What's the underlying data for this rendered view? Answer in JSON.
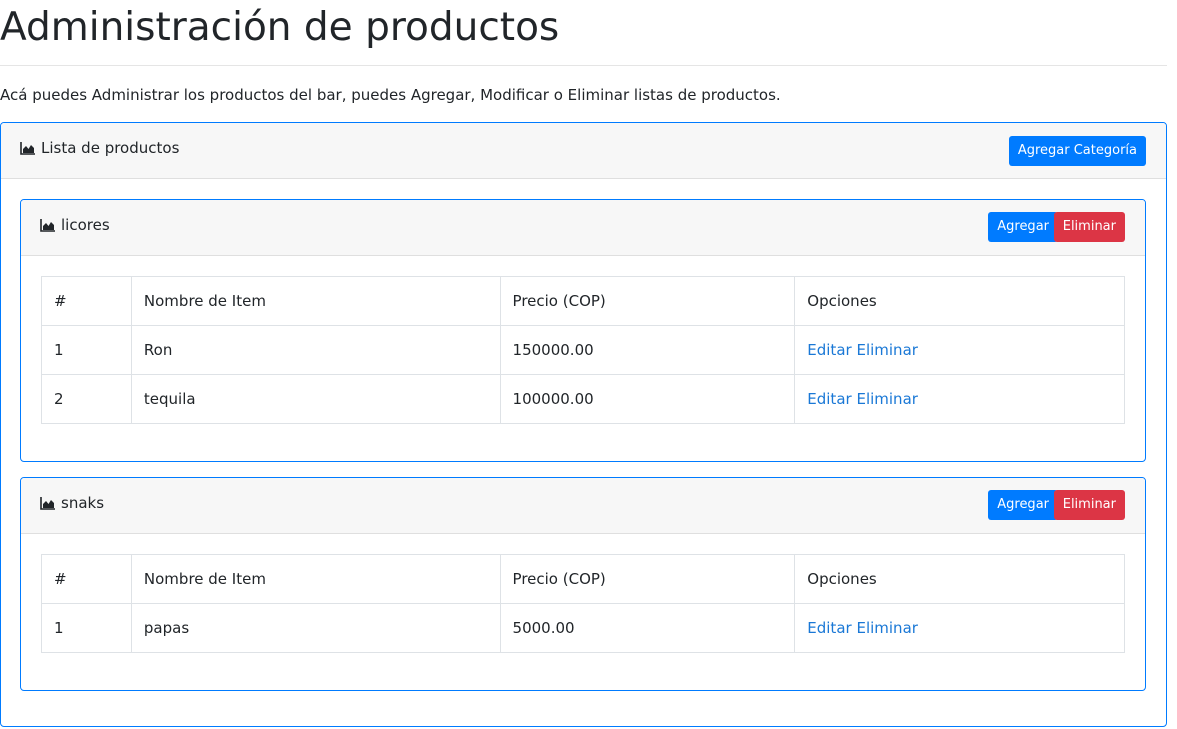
{
  "page": {
    "title": "Administración de productos",
    "description": "Acá puedes Administrar los productos del bar, puedes Agregar, Modificar o Eliminar listas de productos."
  },
  "colors": {
    "primary": "#007bff",
    "danger": "#dc3545",
    "link": "#1a78d6",
    "header_bg": "#f7f7f7"
  },
  "product_list": {
    "icon": "area-chart-icon",
    "title": "Lista de productos",
    "add_category_label": "Agregar Categoría",
    "categories": [
      {
        "name": "licores",
        "add_label": "Agregar",
        "delete_label": "Eliminar",
        "columns": [
          "#",
          "Nombre de Item",
          "Precio (COP)",
          "Opciones"
        ],
        "rows": [
          {
            "num": "1",
            "name": "Ron",
            "price": "150000.00",
            "edit_label": "Editar",
            "delete_label": "Eliminar"
          },
          {
            "num": "2",
            "name": "tequila",
            "price": "100000.00",
            "edit_label": "Editar",
            "delete_label": "Eliminar"
          }
        ]
      },
      {
        "name": "snaks",
        "add_label": "Agregar",
        "delete_label": "Eliminar",
        "columns": [
          "#",
          "Nombre de Item",
          "Precio (COP)",
          "Opciones"
        ],
        "rows": [
          {
            "num": "1",
            "name": "papas",
            "price": "5000.00",
            "edit_label": "Editar",
            "delete_label": "Eliminar"
          }
        ]
      }
    ]
  }
}
